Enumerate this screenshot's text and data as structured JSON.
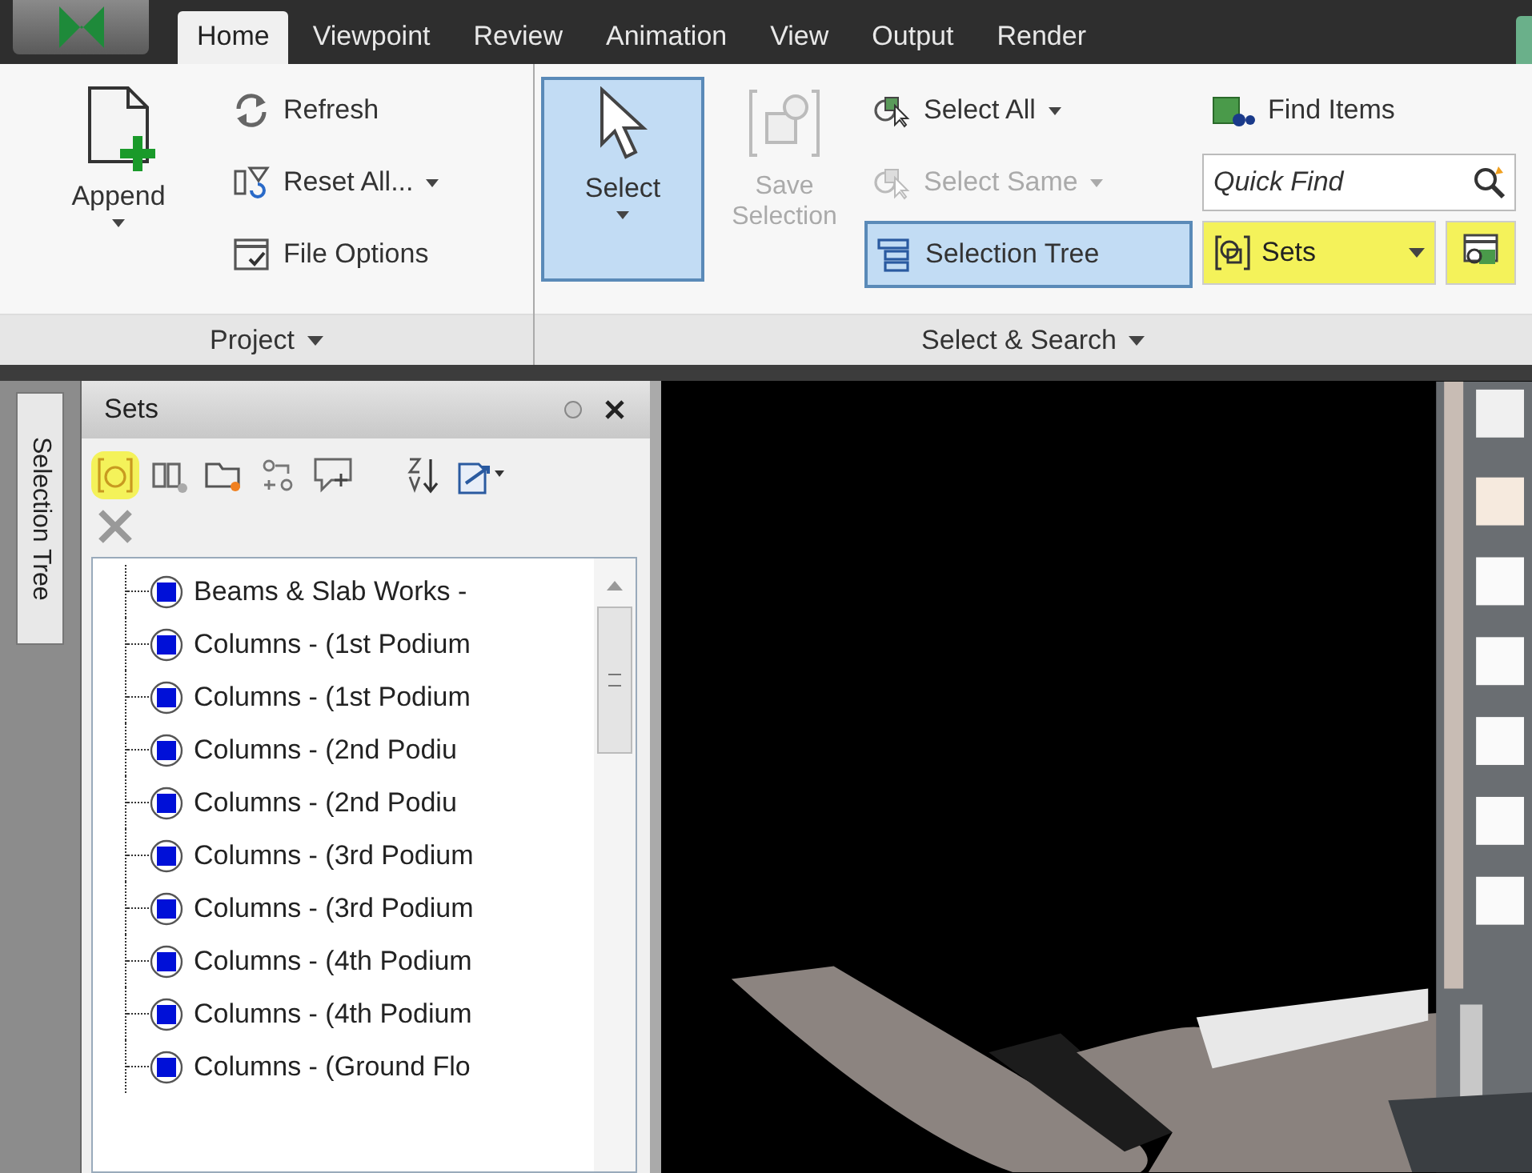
{
  "app_tabs": [
    {
      "label": "Home",
      "selected": true
    },
    {
      "label": "Viewpoint",
      "selected": false
    },
    {
      "label": "Review",
      "selected": false
    },
    {
      "label": "Animation",
      "selected": false
    },
    {
      "label": "View",
      "selected": false
    },
    {
      "label": "Output",
      "selected": false
    },
    {
      "label": "Render",
      "selected": false
    }
  ],
  "project_panel": {
    "title": "Project",
    "append": {
      "label": "Append"
    },
    "buttons": [
      {
        "label": "Refresh",
        "dropdown": false
      },
      {
        "label": "Reset All...",
        "dropdown": true
      },
      {
        "label": "File Options",
        "dropdown": false
      }
    ]
  },
  "select_panel": {
    "title": "Select & Search",
    "select": {
      "label": "Select",
      "selected": true
    },
    "save_selection": {
      "label": "Save Selection",
      "disabled": true
    },
    "buttons": [
      {
        "label": "Select All",
        "dropdown": true,
        "disabled": false,
        "selected": false
      },
      {
        "label": "Select Same",
        "dropdown": true,
        "disabled": true,
        "selected": false
      },
      {
        "label": "Selection Tree",
        "dropdown": false,
        "disabled": false,
        "selected": true
      }
    ],
    "find_items": {
      "label": "Find Items"
    },
    "quick_find": {
      "placeholder": "Quick Find"
    },
    "sets": {
      "label": "Sets",
      "highlighted": true
    }
  },
  "side_tab": {
    "label": "Selection Tree"
  },
  "sets_panel": {
    "title": "Sets",
    "toolbar": [
      {
        "highlighted": true
      },
      {
        "highlighted": false
      },
      {
        "highlighted": false
      },
      {
        "highlighted": false
      },
      {
        "highlighted": false
      },
      {
        "highlighted": false
      },
      {
        "highlighted": false
      }
    ],
    "items": [
      {
        "label": "Beams & Slab Works -"
      },
      {
        "label": "Columns - (1st Podium"
      },
      {
        "label": "Columns - (1st Podium"
      },
      {
        "label": "Columns - (2nd Podiu"
      },
      {
        "label": "Columns - (2nd Podiu"
      },
      {
        "label": "Columns - (3rd Podium"
      },
      {
        "label": "Columns - (3rd Podium"
      },
      {
        "label": "Columns - (4th Podium"
      },
      {
        "label": "Columns - (4th Podium"
      },
      {
        "label": "Columns - (Ground Flo"
      }
    ]
  }
}
